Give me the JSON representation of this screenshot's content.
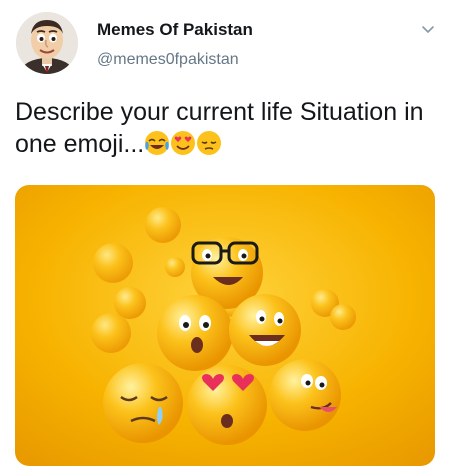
{
  "tweet": {
    "display_name": "Memes Of Pakistan",
    "handle": "@memes0fpakistan",
    "text": "Describe your current life Situation in one emoji...",
    "inline_emojis": [
      "tears-of-joy-emoji",
      "heart-eyes-emoji",
      "pensive-emoji"
    ],
    "menu_icon": "chevron-down-icon",
    "avatar_icon": "profile-avatar",
    "media_icon": "emoji-pile-image"
  },
  "colors": {
    "handle": "#657786",
    "text": "#14171a",
    "media_background": "#f7b300",
    "emoji_yellow": "#fbc21a"
  }
}
